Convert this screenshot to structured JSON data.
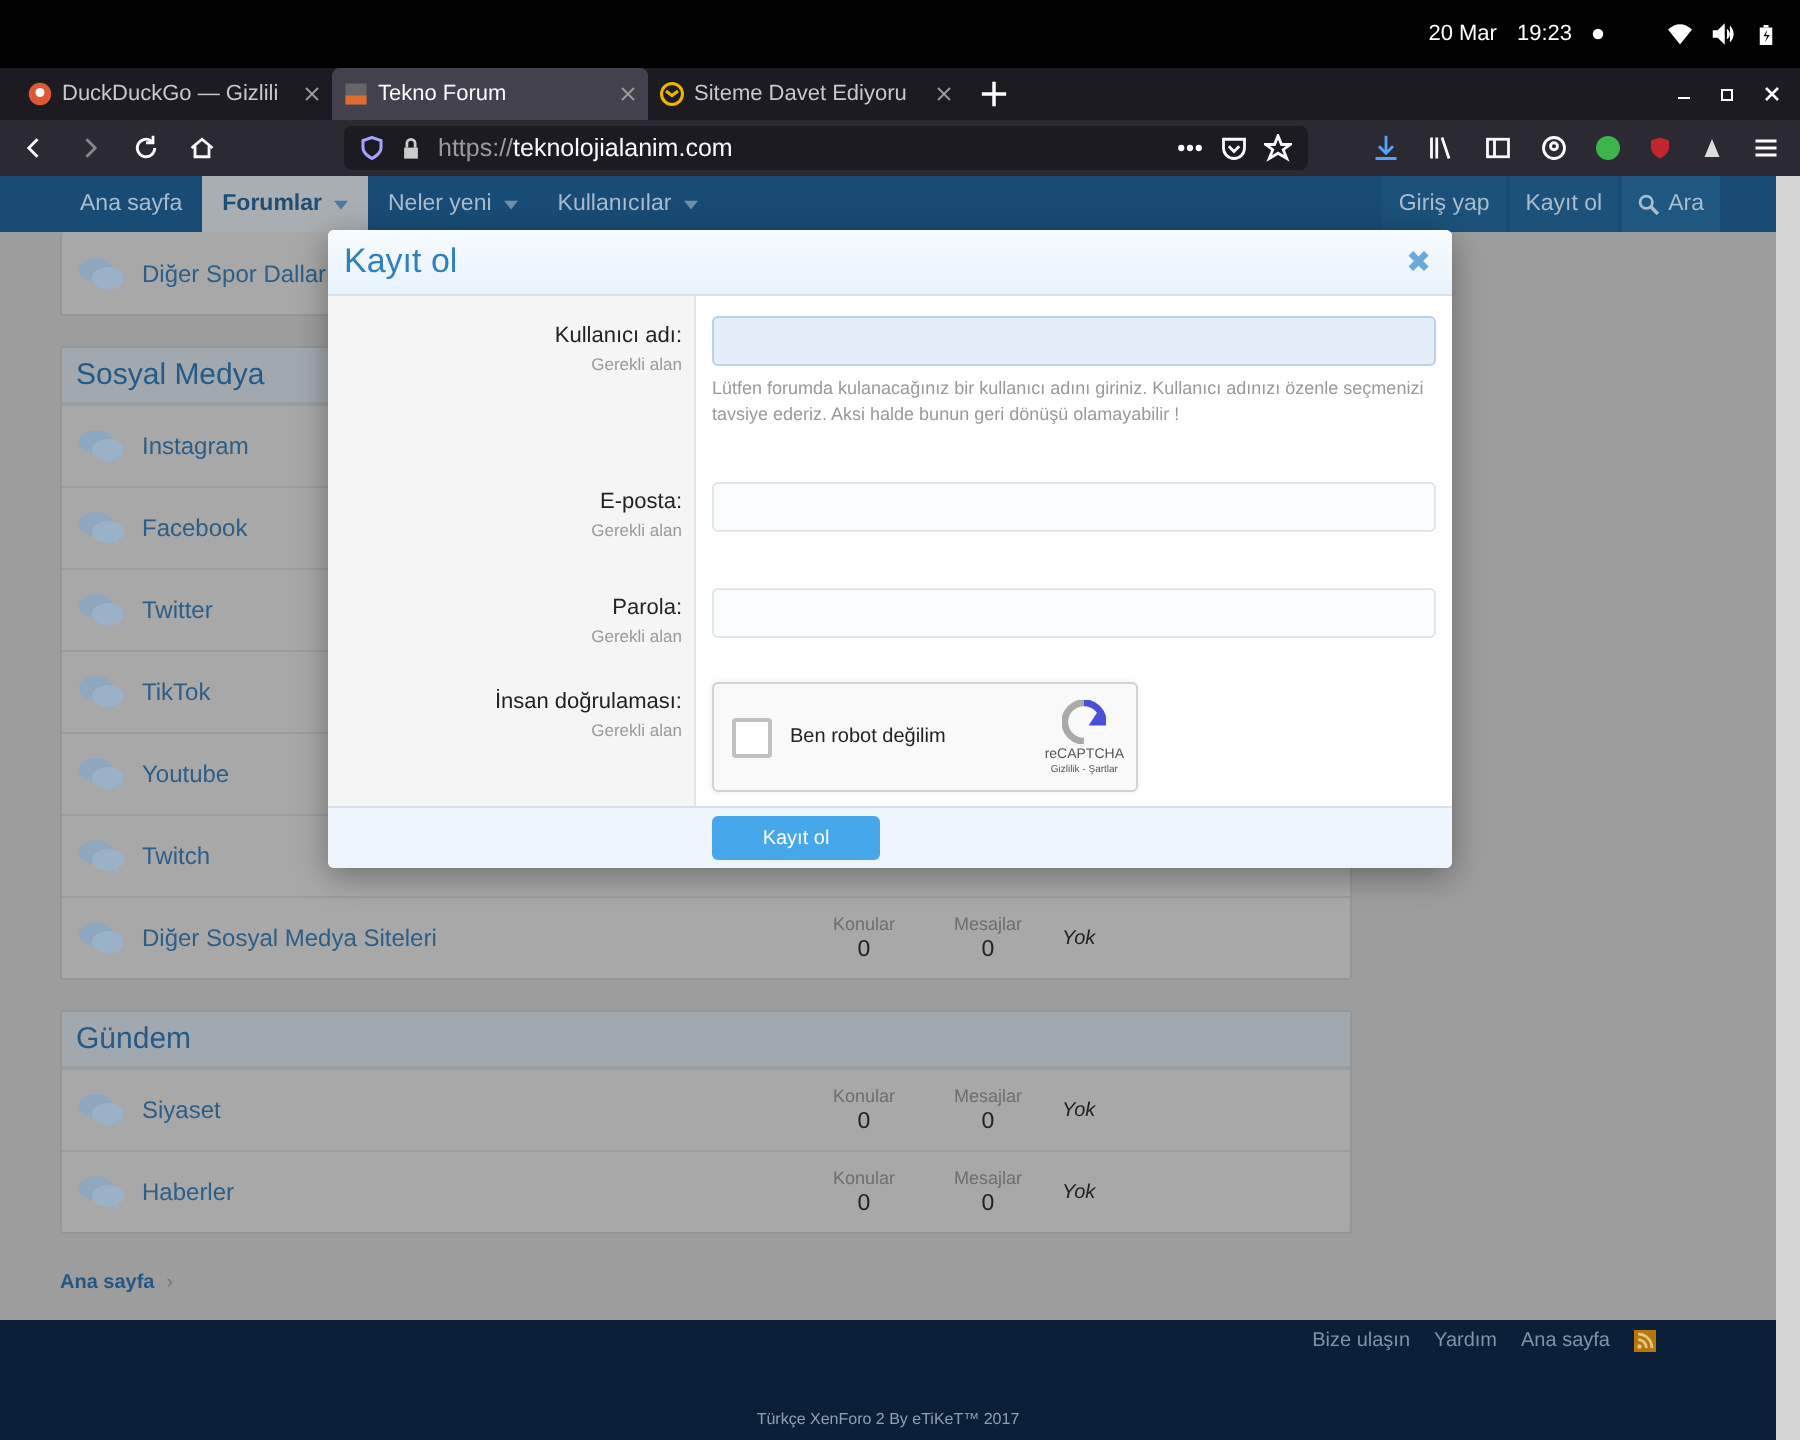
{
  "system_bar": {
    "date": "20 Mar",
    "time": "19:23"
  },
  "browser_tabs": [
    {
      "title": "DuckDuckGo — Gizlili",
      "selected": false
    },
    {
      "title": "Tekno Forum",
      "selected": true
    },
    {
      "title": "Siteme Davet Ediyoru",
      "selected": false
    }
  ],
  "address_bar": {
    "url_prefix": "https://",
    "url_host": "teknolojialanim.com"
  },
  "forum_nav": {
    "items": [
      {
        "label": "Ana sayfa",
        "selected": false,
        "dropdown": false
      },
      {
        "label": "Forumlar",
        "selected": true,
        "dropdown": true
      },
      {
        "label": "Neler yeni",
        "selected": false,
        "dropdown": true
      },
      {
        "label": "Kullanıcılar",
        "selected": false,
        "dropdown": true
      }
    ],
    "right_items": [
      {
        "label": "Giriş yap",
        "kind": "link"
      },
      {
        "label": "Kayıt ol",
        "kind": "link"
      },
      {
        "label": "Ara",
        "kind": "search"
      }
    ]
  },
  "top_forum": {
    "name": "Diğer Spor Dallar"
  },
  "sections": [
    {
      "title": "Sosyal Medya",
      "forums": [
        {
          "name": "Instagram"
        },
        {
          "name": "Facebook"
        },
        {
          "name": "Twitter"
        },
        {
          "name": "TikTok"
        },
        {
          "name": "Youtube"
        },
        {
          "name": "Twitch"
        },
        {
          "name": "Diğer Sosyal Medya Siteleri",
          "stats": {
            "topics_label": "Konular",
            "topics": "0",
            "messages_label": "Mesajlar",
            "messages": "0",
            "last": "Yok"
          }
        }
      ]
    },
    {
      "title": "Gündem",
      "forums": [
        {
          "name": "Siyaset",
          "stats": {
            "topics_label": "Konular",
            "topics": "0",
            "messages_label": "Mesajlar",
            "messages": "0",
            "last": "Yok"
          }
        },
        {
          "name": "Haberler",
          "stats": {
            "topics_label": "Konular",
            "topics": "0",
            "messages_label": "Mesajlar",
            "messages": "0",
            "last": "Yok"
          }
        }
      ]
    }
  ],
  "breadcrumb": {
    "label": "Ana sayfa",
    "separator": "›"
  },
  "footer": {
    "links": [
      "Bize ulaşın",
      "Yardım",
      "Ana sayfa"
    ],
    "copyright": "Türkçe XenForo 2 By eTiKeT™ 2017"
  },
  "modal": {
    "title": "Kayıt ol",
    "close": "✖",
    "fields": [
      {
        "kind": "text",
        "label": "Kullanıcı adı:",
        "hint": "Gerekli alan",
        "focused": true,
        "explain": "Lütfen forumda kulanacağınız bir kullanıcı adını giriniz. Kullanıcı adınızı özenle seçmenizi tavsiye ederiz. Aksi halde bunun geri dönüşü olamayabilir !"
      },
      {
        "kind": "text",
        "label": "E-posta:",
        "hint": "Gerekli alan",
        "focused": false
      },
      {
        "kind": "password",
        "label": "Parola:",
        "hint": "Gerekli alan",
        "focused": false
      },
      {
        "kind": "captcha",
        "label": "İnsan doğrulaması:",
        "hint": "Gerekli alan",
        "checkbox_label": "Ben robot değilim",
        "checked": false,
        "brand": "reCAPTCHA",
        "links": "Gizlilik - Şartlar"
      }
    ],
    "submit": "Kayıt ol"
  }
}
